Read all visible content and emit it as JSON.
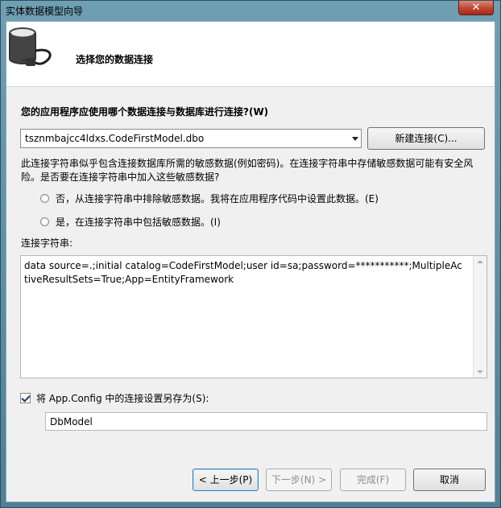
{
  "window": {
    "title": "实体数据模型向导",
    "close_glyph": "✕"
  },
  "header": {
    "title": "选择您的数据连接",
    "icon": "database-plug-icon"
  },
  "question_label": "您的应用程序应使用哪个数据连接与数据库进行连接?(W)",
  "connection_select": {
    "value": "tsznmbajcc4ldxs.CodeFirstModel.dbo"
  },
  "new_connection_button": "新建连接(C)...",
  "sensitive_description": "此连接字符串似乎包含连接数据库所需的敏感数据(例如密码)。在连接字符串中存储敏感数据可能有安全风险。是否要在连接字符串中加入这些敏感数据?",
  "radio_exclude": "否，从连接字符串中排除敏感数据。我将在应用程序代码中设置此数据。(E)",
  "radio_include": "是，在连接字符串中包括敏感数据。(I)",
  "connection_string_label": "连接字符串:",
  "connection_string_value": "data source=.;initial catalog=CodeFirstModel;user id=sa;password=***********;MultipleActiveResultSets=True;App=EntityFramework",
  "save_checkbox_label": "将 App.Config 中的连接设置另存为(S):",
  "save_checkbox_checked": true,
  "model_name": "DbModel",
  "buttons": {
    "back": "< 上一步(P)",
    "next": "下一步(N) >",
    "finish": "完成(F)",
    "cancel": "取消"
  }
}
